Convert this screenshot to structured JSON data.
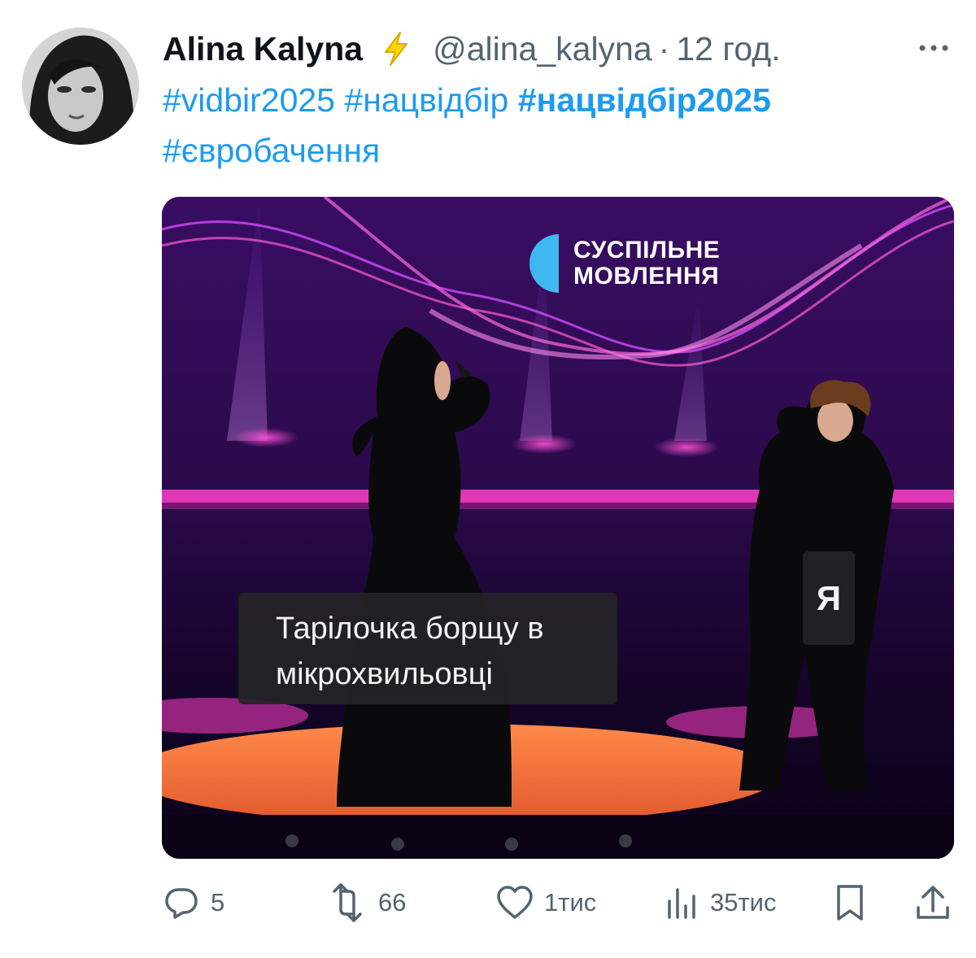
{
  "tweet": {
    "author": {
      "display_name": "Alina Kalyna",
      "handle": "@alina_kalyna",
      "badge_icon": "lightning-bolt-icon"
    },
    "separator": "·",
    "timestamp": "12 год.",
    "hashtags": [
      "#vidbir2025",
      "#нацвідбір",
      "#нацвідбір2025",
      "#євробачення"
    ],
    "media": {
      "logo_line1": "СУСПІЛЬНЕ",
      "logo_line2": "МОВЛЕННЯ",
      "caption_line1": "Тарілочка борщу в",
      "caption_line2": "мікрохвильовці",
      "label_me": "Я"
    },
    "actions": {
      "replies": "5",
      "reposts": "66",
      "likes": "1тис",
      "views": "35тис"
    }
  },
  "colors": {
    "link": "#1d9bf0",
    "text": "#0f1419",
    "muted": "#536471",
    "bolt": "#ffd400"
  }
}
